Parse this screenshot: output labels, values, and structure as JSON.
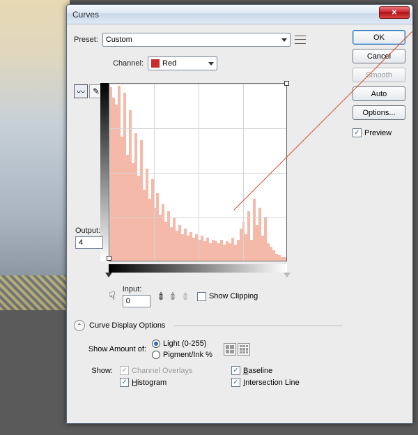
{
  "window": {
    "title": "Curves"
  },
  "preset": {
    "label": "Preset:",
    "value": "Custom"
  },
  "buttons": {
    "ok": "OK",
    "cancel": "Cancel",
    "smooth": "Smooth",
    "auto": "Auto",
    "options": "Options..."
  },
  "preview": {
    "label": "Preview",
    "checked": true
  },
  "channel": {
    "label": "Channel:",
    "value": "Red"
  },
  "output": {
    "label": "Output:",
    "value": "4"
  },
  "input": {
    "label": "Input:",
    "value": "0"
  },
  "show_clipping": {
    "label": "Show Clipping",
    "checked": false
  },
  "display_options": {
    "toggle_label": "Curve Display Options",
    "amount_label": "Show Amount of:",
    "light_label": "Light  (0-255)",
    "pigment_label": "Pigment/Ink %",
    "show_label": "Show:",
    "channel_overlays": "Channel Overlays",
    "baseline": "Baseline",
    "histogram": "Histogram",
    "intersection": "Intersection Line"
  },
  "chart_data": {
    "type": "line",
    "title": "Red channel curve",
    "xlabel": "Input",
    "ylabel": "Output",
    "xlim": [
      0,
      255
    ],
    "ylim": [
      0,
      255
    ],
    "series": [
      {
        "name": "curve",
        "x": [
          0,
          255
        ],
        "y": [
          4,
          255
        ]
      }
    ],
    "histogram_note": "Red-channel histogram shown behind curve; tall spikes near 0-60 input, tapering mid-range, small cluster near 230-250.",
    "grid": "4x4",
    "black_point_marker": 0,
    "white_point_marker": 255
  }
}
